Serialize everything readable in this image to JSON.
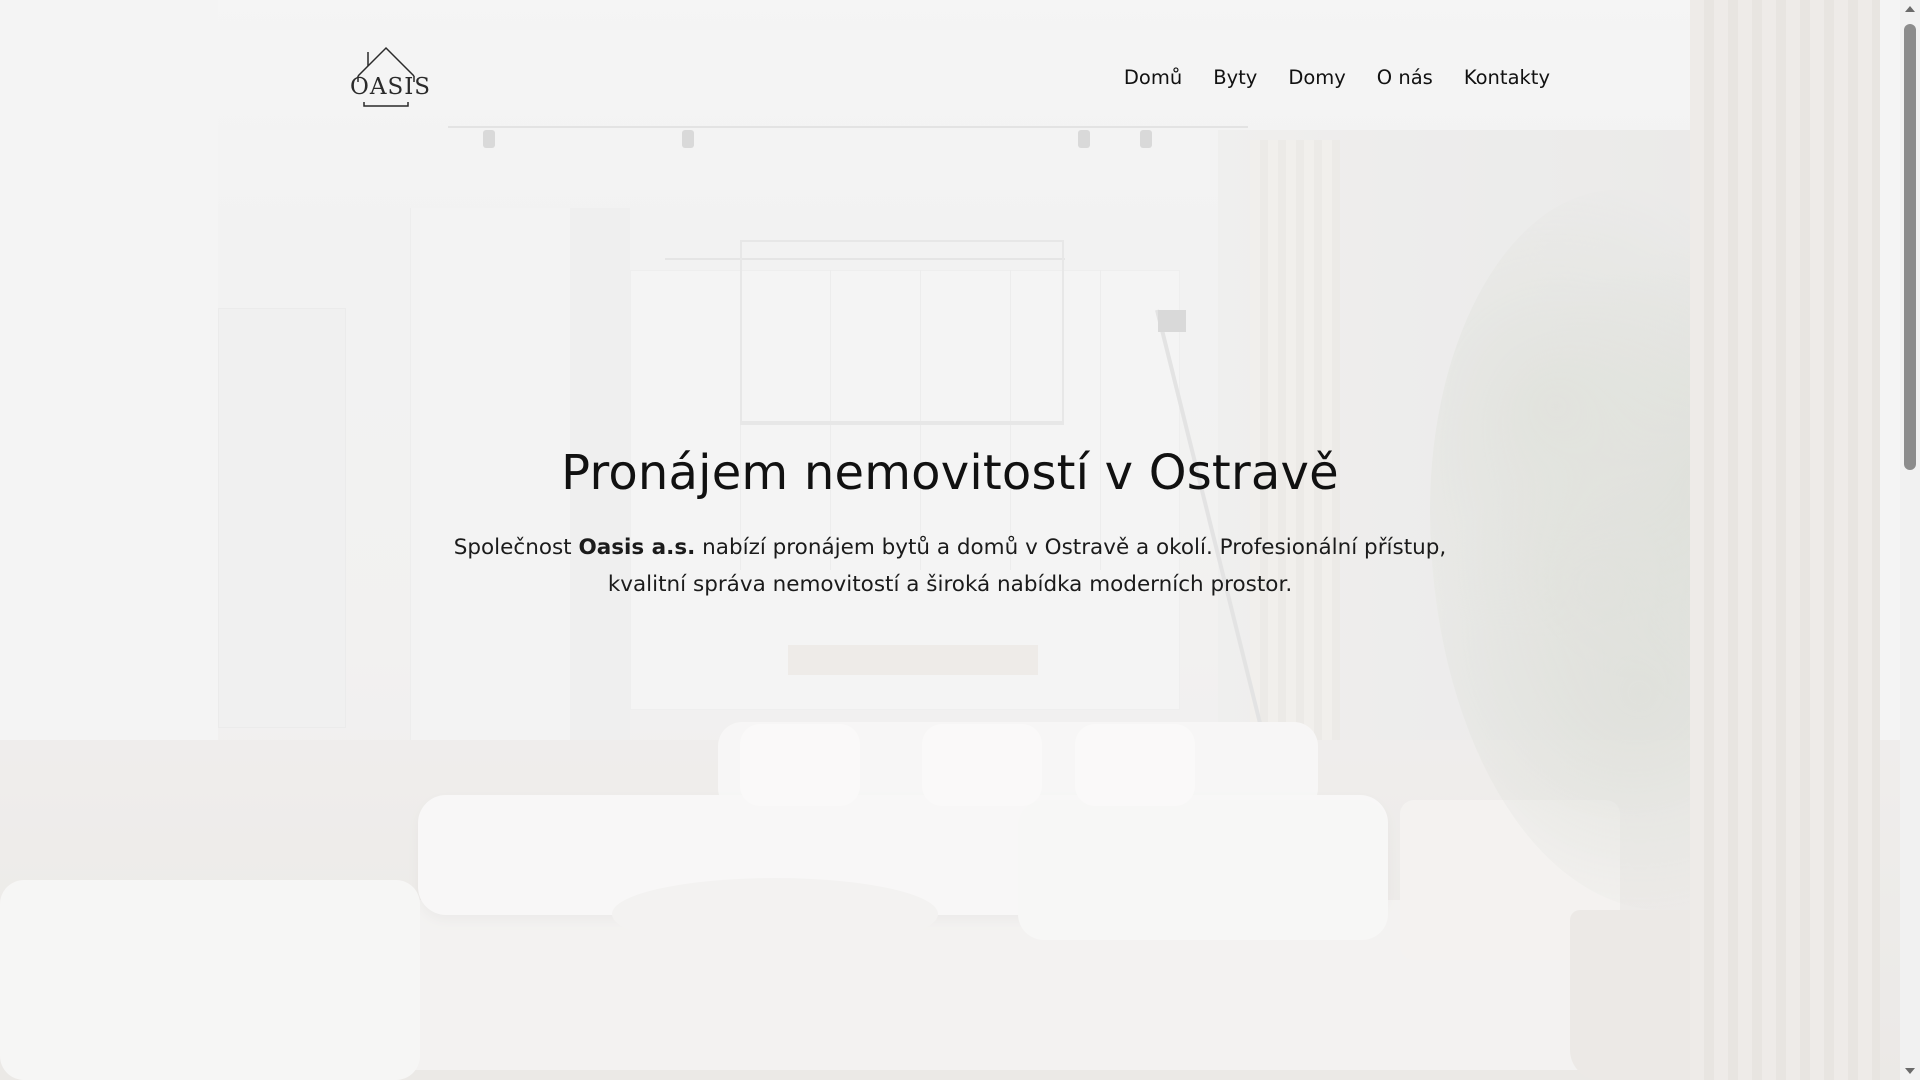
{
  "brand": {
    "logo_text": "OASIS",
    "logo_icon": "house-roof-icon"
  },
  "nav": {
    "items": [
      {
        "label": "Domů"
      },
      {
        "label": "Byty"
      },
      {
        "label": "Domy"
      },
      {
        "label": "O nás"
      },
      {
        "label": "Kontakty"
      }
    ]
  },
  "hero": {
    "title": "Pronájem nemovitostí v Ostravě",
    "desc_prefix": "Společnost ",
    "desc_company": "Oasis a.s.",
    "desc_suffix": " nabízí pronájem bytů a domů v Ostravě a okolí. Profesionální přístup, kvalitní správa nemovitostí a široká nabídka moderních prostor."
  },
  "colors": {
    "text": "#111111",
    "background": "#eeeeee",
    "scrollbar_thumb": "#8c8c8c"
  }
}
